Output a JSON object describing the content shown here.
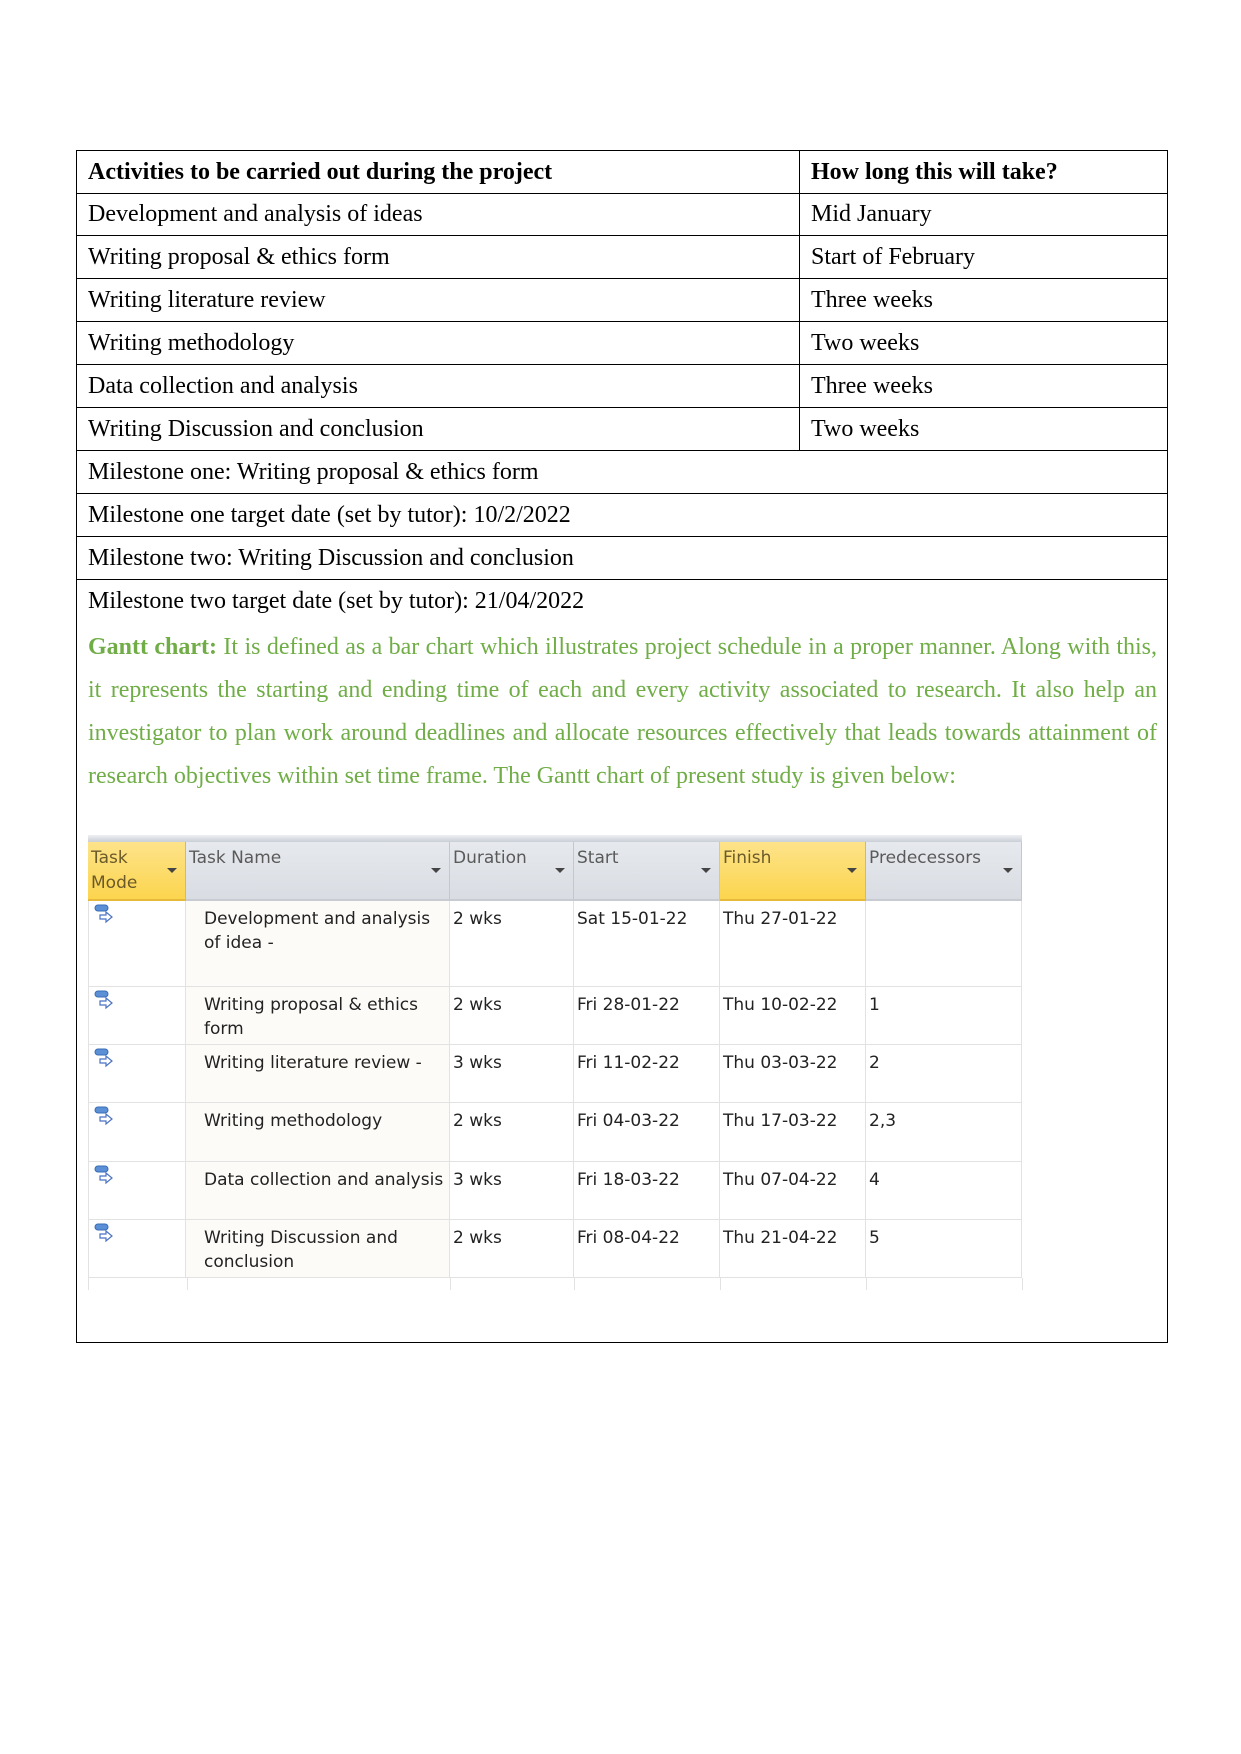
{
  "plan_table": {
    "header": {
      "activities": "Activities to be carried out during the project",
      "duration": "How long this will take?"
    },
    "rows": [
      {
        "activity": "Development and analysis of ideas",
        "duration": "Mid January"
      },
      {
        "activity": "Writing proposal & ethics form",
        "duration": "Start of February"
      },
      {
        "activity": "Writing literature review",
        "duration": "Three weeks"
      },
      {
        "activity": "Writing methodology",
        "duration": "Two weeks"
      },
      {
        "activity": "Data collection and analysis",
        "duration": "Three weeks"
      },
      {
        "activity": "Writing Discussion and conclusion",
        "duration": "Two weeks"
      }
    ],
    "milestones": [
      "Milestone one: Writing proposal & ethics form",
      "Milestone one target date (set by tutor): 10/2/2022",
      "Milestone two: Writing Discussion and conclusion",
      "Milestone two target date (set by tutor): 21/04/2022"
    ]
  },
  "gantt_description": {
    "label": "Gantt chart:",
    "text": " It is defined as a bar chart which illustrates project schedule in a proper manner. Along with this, it represents the starting and ending time of each and every activity associated to research. It also help an investigator to plan work around deadlines and allocate resources effectively that leads towards attainment of research objectives within set time frame. The Gantt chart of present study is given below:",
    "color": "#70ad47"
  },
  "gantt": {
    "columns": [
      {
        "label": "Task Mode",
        "highlighted": true
      },
      {
        "label": "Task Name",
        "highlighted": false
      },
      {
        "label": "Duration",
        "highlighted": false
      },
      {
        "label": "Start",
        "highlighted": false
      },
      {
        "label": "Finish",
        "highlighted": true
      },
      {
        "label": "Predecessors",
        "highlighted": false
      }
    ],
    "task_mode_icon": "auto-scheduled-task-icon",
    "tasks": [
      {
        "name": "Development and analysis of idea -",
        "duration": "2 wks",
        "start": "Sat 15-01-22",
        "finish": "Thu 27-01-22",
        "predecessors": ""
      },
      {
        "name": "Writing proposal & ethics form",
        "duration": "2 wks",
        "start": "Fri 28-01-22",
        "finish": "Thu 10-02-22",
        "predecessors": "1"
      },
      {
        "name": "Writing literature review -",
        "duration": "3 wks",
        "start": "Fri 11-02-22",
        "finish": "Thu 03-03-22",
        "predecessors": "2"
      },
      {
        "name": "Writing methodology",
        "duration": "2 wks",
        "start": "Fri 04-03-22",
        "finish": "Thu 17-03-22",
        "predecessors": "2,3"
      },
      {
        "name": "Data collection and analysis",
        "duration": "3 wks",
        "start": "Fri 18-03-22",
        "finish": "Thu 07-04-22",
        "predecessors": "4"
      },
      {
        "name": "Writing Discussion and conclusion",
        "duration": "2 wks",
        "start": "Fri 08-04-22",
        "finish": "Thu 21-04-22",
        "predecessors": "5"
      }
    ]
  }
}
